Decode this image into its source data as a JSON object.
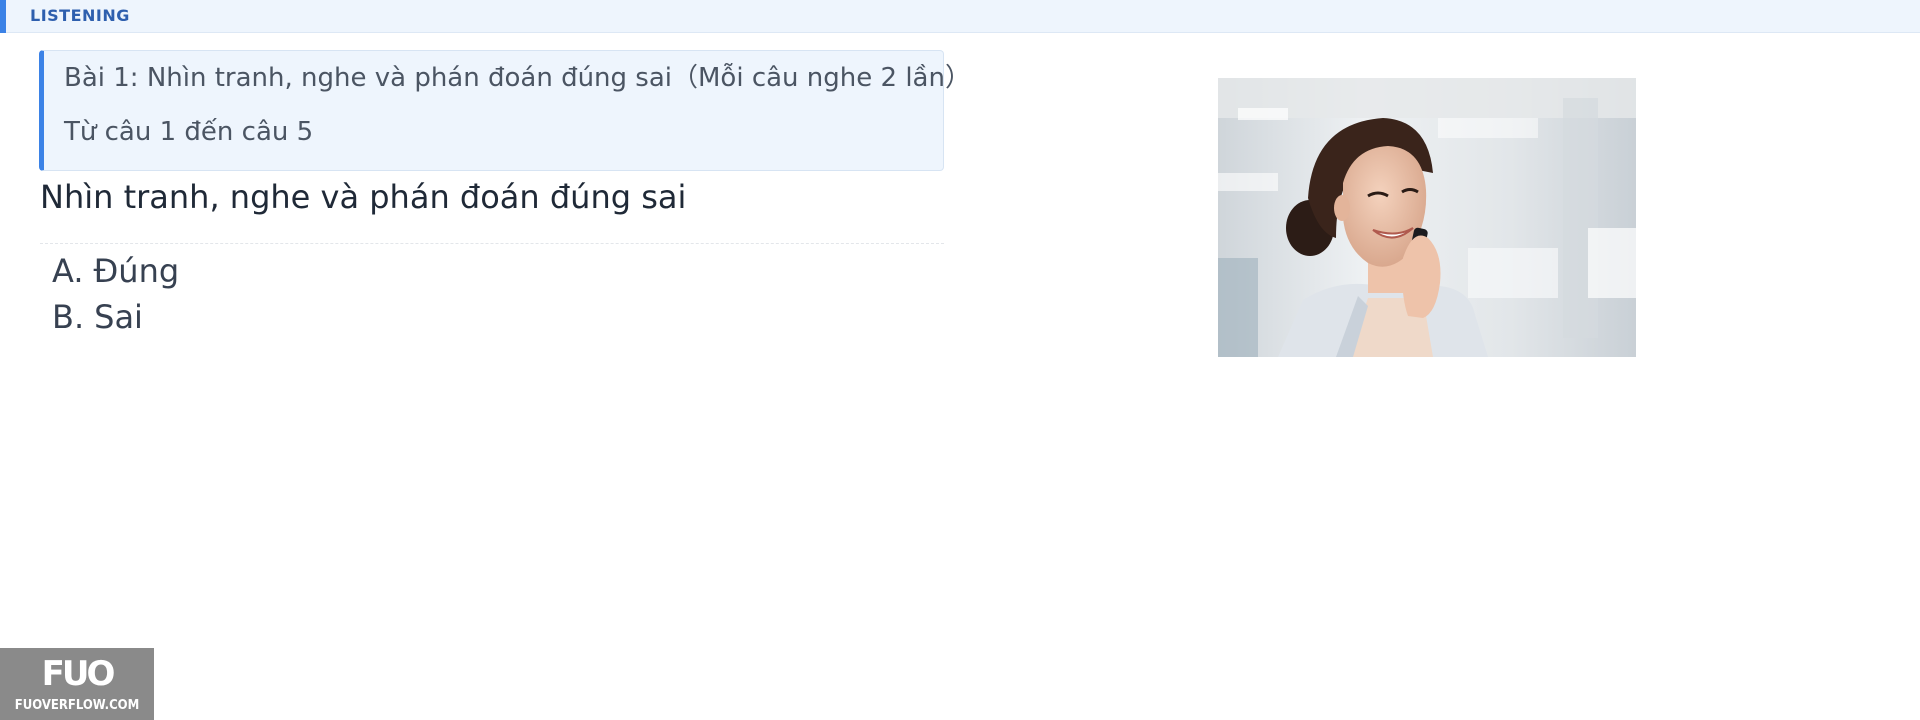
{
  "section": {
    "label": "LISTENING",
    "accent_color": "#3b82e6",
    "background": "#eef5fd"
  },
  "instruction": {
    "line1": "Bài 1: Nhìn tranh, nghe và phán đoán đúng sai（Mỗi câu nghe 2 lần）",
    "line2": "Từ câu 1 đến câu 5"
  },
  "question": {
    "text": "Nhìn tranh, nghe và phán đoán đúng sai"
  },
  "options": [
    {
      "letter": "A.",
      "text": "Đúng"
    },
    {
      "letter": "B.",
      "text": "Sai"
    }
  ],
  "image": {
    "subject": "smiling woman talking on a mobile phone"
  },
  "watermark": {
    "logo": "FUO",
    "site": "FUOVERFLOW.COM"
  }
}
